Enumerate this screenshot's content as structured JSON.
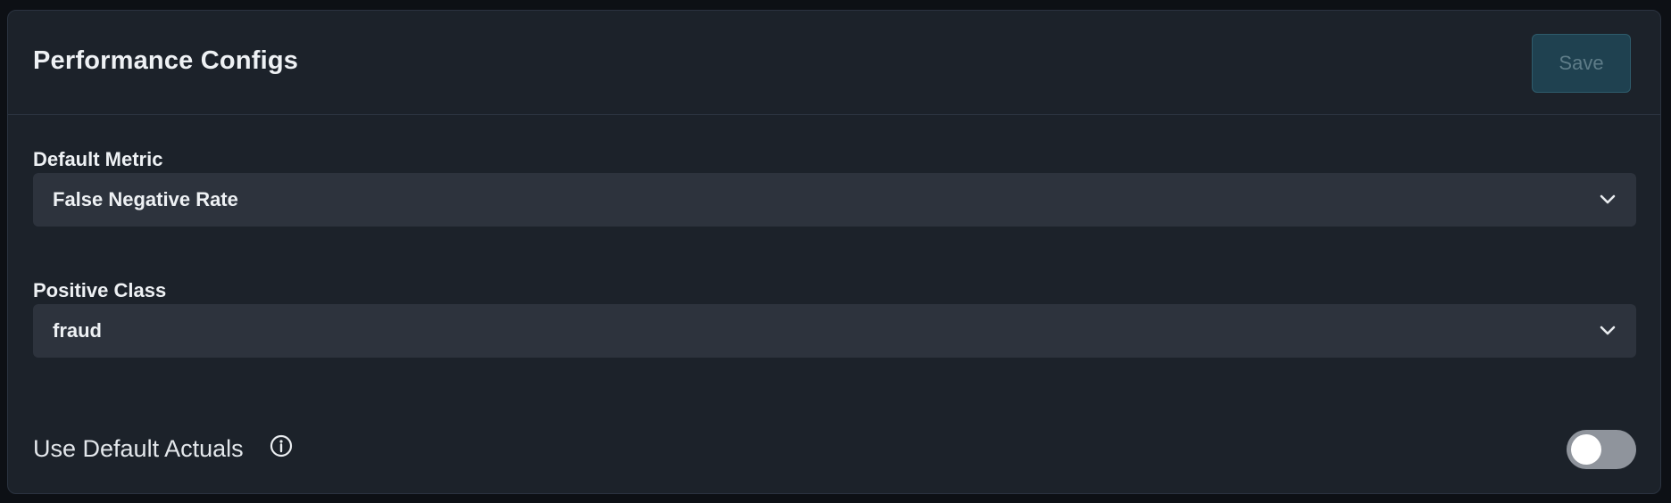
{
  "panel": {
    "title": "Performance Configs",
    "save_label": "Save"
  },
  "default_metric": {
    "label": "Default Metric",
    "value": "False Negative Rate",
    "icon": "chevron-down-icon"
  },
  "positive_class": {
    "label": "Positive Class",
    "value": "fraud",
    "icon": "chevron-down-icon"
  },
  "use_default_actuals": {
    "label": "Use Default Actuals",
    "info_icon": "info-icon",
    "enabled": false
  },
  "colors": {
    "background": "#0d1015",
    "panel": "#1c222a",
    "select": "#2d333d",
    "save_button": "#1f4150",
    "toggle_off": "#8f949c"
  }
}
